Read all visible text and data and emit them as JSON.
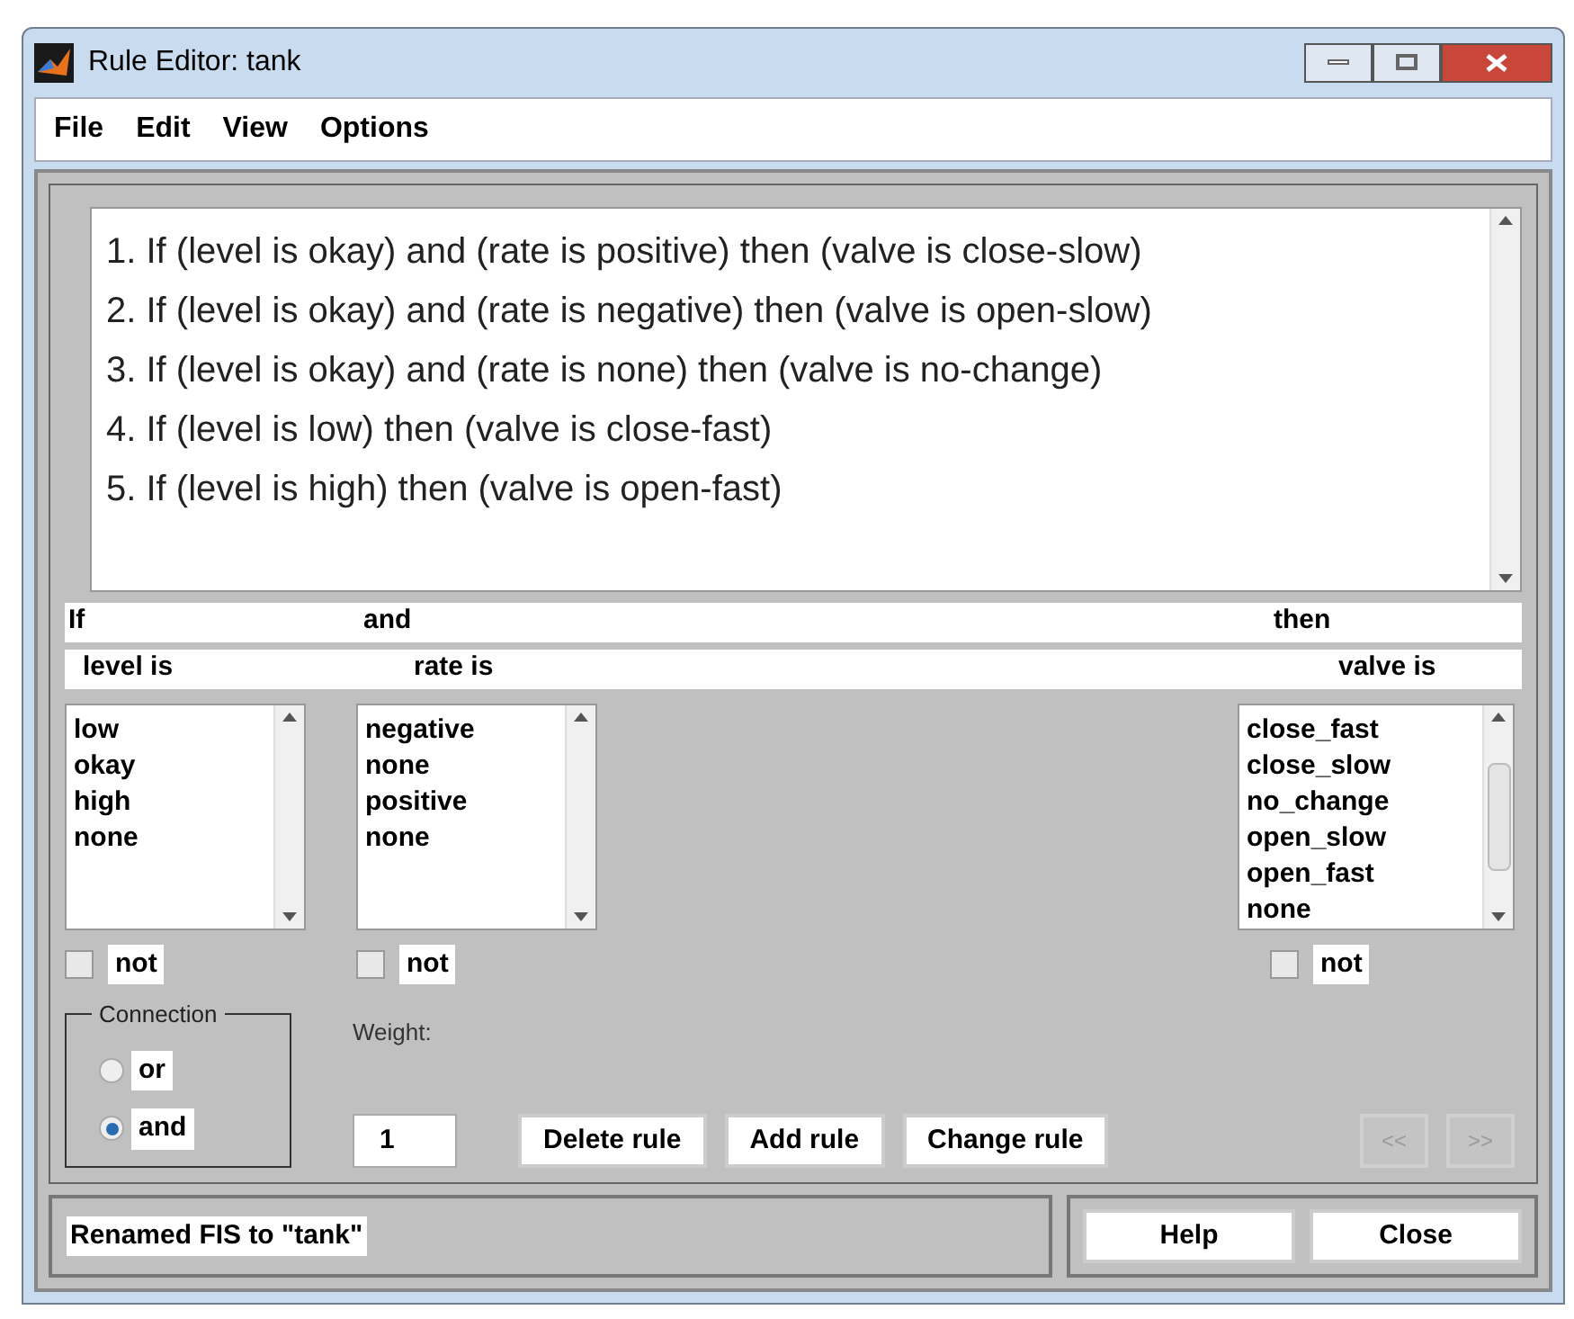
{
  "window": {
    "title": "Rule Editor: tank"
  },
  "menu": [
    "File",
    "Edit",
    "View",
    "Options"
  ],
  "rules": [
    "1. If (level is okay) and (rate is positive) then (valve is close-slow)",
    "2. If (level is okay) and (rate is negative) then (valve is open-slow)",
    "3. If (level is okay) and (rate is none) then (valve is no-change)",
    "4. If (level is low) then (valve is close-fast)",
    "5. If (level is high) then (valve is open-fast)"
  ],
  "headers": {
    "if": "If",
    "and": "and",
    "then": "then"
  },
  "inputs": [
    {
      "label": "level is",
      "items": [
        "low",
        "okay",
        "high",
        "none"
      ],
      "not_label": "not",
      "not_checked": false
    },
    {
      "label": "rate is",
      "items": [
        "negative",
        "none",
        "positive",
        "none"
      ],
      "not_label": "not",
      "not_checked": false
    }
  ],
  "output": {
    "label": "valve is",
    "items": [
      "close_fast",
      "close_slow",
      "no_change",
      "open_slow",
      "open_fast",
      "none"
    ],
    "not_label": "not",
    "not_checked": false
  },
  "connection": {
    "title": "Connection",
    "options": [
      {
        "label": "or",
        "selected": false
      },
      {
        "label": "and",
        "selected": true
      }
    ]
  },
  "weight": {
    "label": "Weight:",
    "value": "1"
  },
  "buttons": [
    "Delete rule",
    "Add rule",
    "Change rule"
  ],
  "nav": [
    {
      "label": "<<",
      "disabled": true
    },
    {
      "label": ">>",
      "disabled": true
    }
  ],
  "status": "Renamed FIS to \"tank\"",
  "footer_buttons": [
    "Help",
    "Close"
  ]
}
